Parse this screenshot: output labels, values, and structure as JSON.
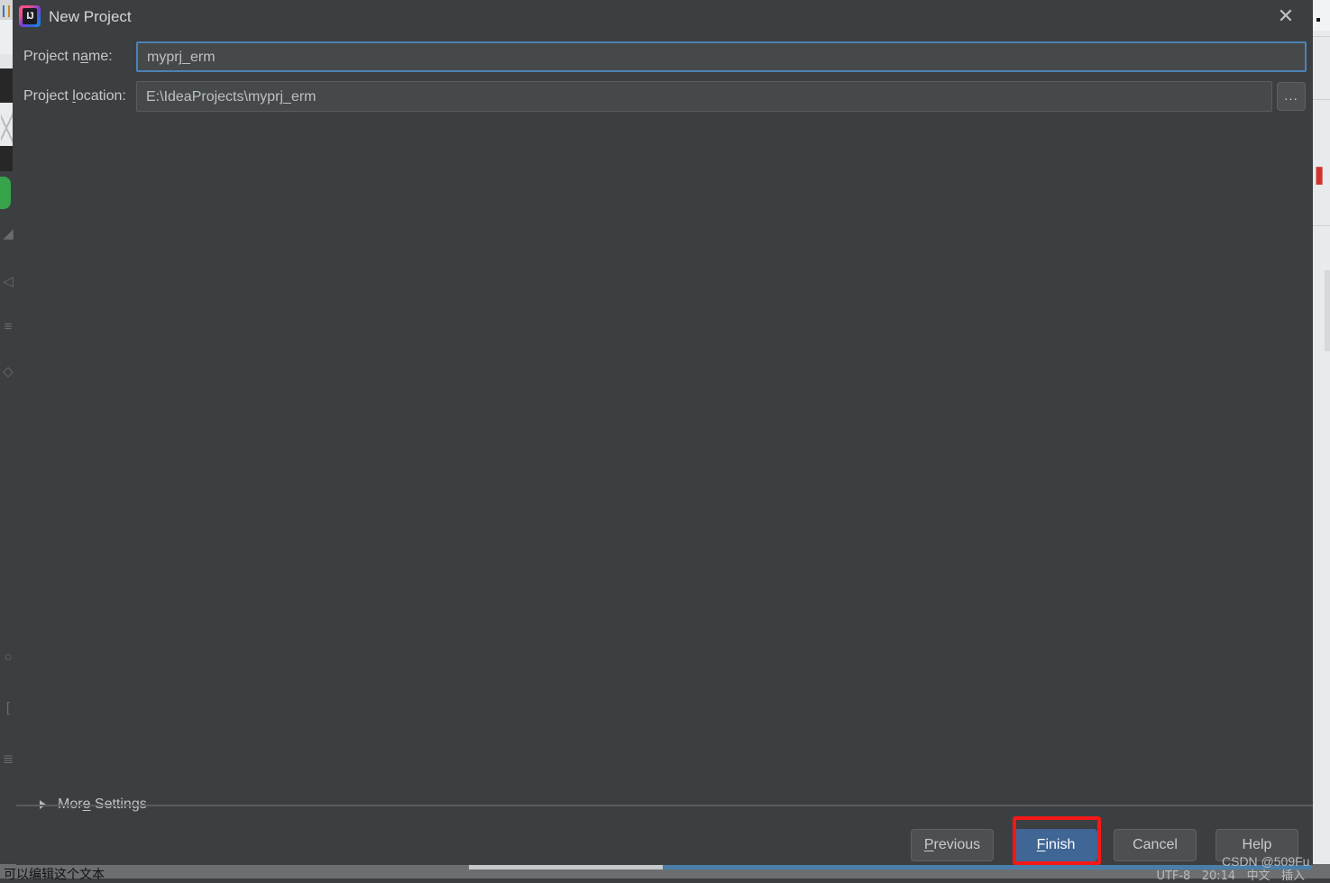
{
  "dialog": {
    "title": "New Project",
    "logo_icon": "intellij-idea-logo",
    "logo_text": "IJ",
    "close_icon": "close-icon"
  },
  "form": {
    "fields": [
      {
        "label_before": "Project n",
        "label_mnemonic": "a",
        "label_after": "me:",
        "value": "myprj_erm",
        "name": "project-name"
      },
      {
        "label_before": "Project ",
        "label_mnemonic": "l",
        "label_after": "ocation:",
        "value": "E:\\IdeaProjects\\myprj_erm",
        "name": "project-location"
      }
    ],
    "browse_label": "...",
    "browse_icon": "ellipsis-icon"
  },
  "more_settings": {
    "label_before": "Mor",
    "label_mnemonic": "e",
    "label_after": " Settings",
    "expand_icon": "chevron-right-icon"
  },
  "footer": {
    "buttons": [
      {
        "before": "",
        "mnemonic": "P",
        "after": "revious",
        "name": "previous-button",
        "primary": false
      },
      {
        "before": "",
        "mnemonic": "F",
        "after": "inish",
        "name": "finish-button",
        "primary": true
      },
      {
        "before": "Cancel",
        "mnemonic": "",
        "after": "",
        "name": "cancel-button",
        "primary": false
      },
      {
        "before": "Help",
        "mnemonic": "",
        "after": "",
        "name": "help-button",
        "primary": false
      }
    ]
  },
  "watermark": {
    "text": "CSDN @509Fu"
  },
  "colors": {
    "dialog_bg": "#3c3f41",
    "field_bg": "#45494a",
    "focus_border": "#4b82b8",
    "primary_button": "#3f6694",
    "annotation_red": "#f71717",
    "accent_green": "#36a34b"
  }
}
